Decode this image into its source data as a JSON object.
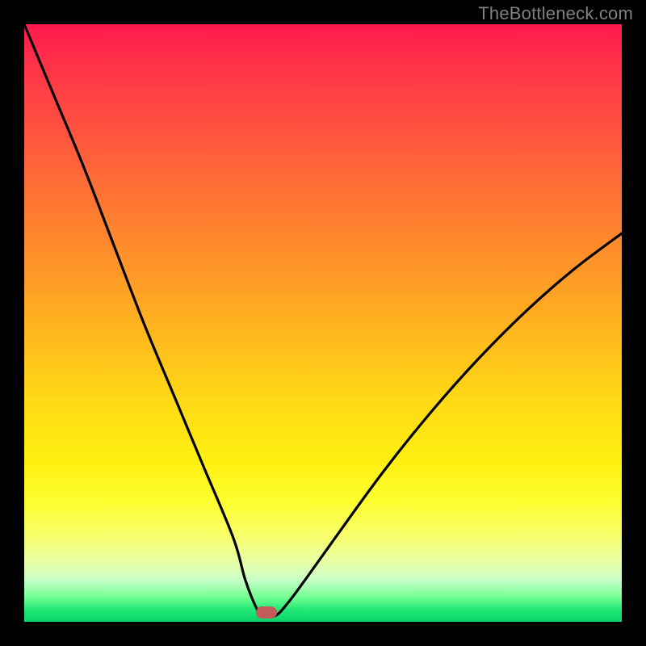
{
  "watermark": "TheBottleneck.com",
  "chart_data": {
    "type": "line",
    "title": "",
    "xlabel": "",
    "ylabel": "",
    "xlim": [
      0,
      100
    ],
    "ylim": [
      0,
      100
    ],
    "grid": false,
    "legend": false,
    "annotations": [
      {
        "label": "optimal-marker",
        "x": 40.5,
        "y": 1.5
      }
    ],
    "series": [
      {
        "name": "bottleneck-curve",
        "x": [
          0,
          5,
          10,
          15,
          20,
          25,
          30,
          35,
          37,
          39,
          40,
          42,
          44,
          47,
          52,
          60,
          68,
          76,
          84,
          92,
          100
        ],
        "values": [
          100,
          88,
          76,
          63,
          50,
          38,
          26,
          14,
          7,
          2,
          1,
          1,
          3,
          7,
          14,
          25,
          35,
          44,
          52,
          59,
          65
        ]
      }
    ],
    "background_gradient": {
      "direction": "vertical",
      "stops": [
        {
          "pos": 0,
          "color": "#ff1a4d"
        },
        {
          "pos": 30,
          "color": "#ff7733"
        },
        {
          "pos": 63,
          "color": "#ffd916"
        },
        {
          "pos": 86,
          "color": "#f7ff70"
        },
        {
          "pos": 96,
          "color": "#70ff90"
        },
        {
          "pos": 100,
          "color": "#0ad468"
        }
      ]
    }
  },
  "frame": {
    "border_color": "#000000",
    "border_thickness_px": 30
  },
  "marker": {
    "color": "#c45a5a",
    "shape": "rounded-rect"
  }
}
